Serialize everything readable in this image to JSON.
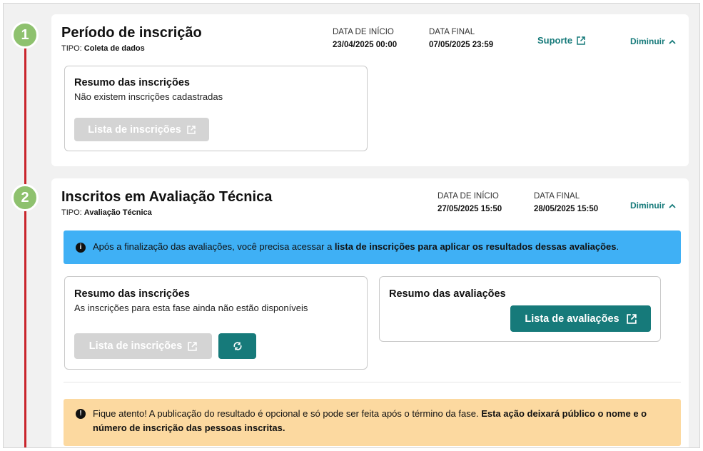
{
  "phases": [
    {
      "number": "1",
      "title": "Período de inscrição",
      "type_label": "TIPO:",
      "type_value": "Coleta de dados",
      "start_label": "DATA DE INÍCIO",
      "start_value": "23/04/2025 00:00",
      "end_label": "DATA FINAL",
      "end_value": "07/05/2025 23:59",
      "support_label": "Suporte",
      "collapse_label": "Diminuir",
      "summary": {
        "title": "Resumo das inscrições",
        "text": "Não existem inscrições cadastradas",
        "button_label": "Lista de inscrições"
      }
    },
    {
      "number": "2",
      "title": "Inscritos em Avaliação Técnica",
      "type_label": "TIPO:",
      "type_value": "Avaliação Técnica",
      "start_label": "DATA DE INÍCIO",
      "start_value": "27/05/2025 15:50",
      "end_label": "DATA FINAL",
      "end_value": "28/05/2025 15:50",
      "collapse_label": "Diminuir",
      "info_alert": {
        "text_before": "Após a finalização das avaliações, você precisa acessar a ",
        "text_bold": "lista de inscrições para aplicar os resultados dessas avaliações",
        "text_after": "."
      },
      "summary": {
        "title": "Resumo das inscrições",
        "text": "As inscrições para esta fase ainda não estão disponíveis",
        "button_label": "Lista de inscrições"
      },
      "evaluations": {
        "title": "Resumo das avaliações",
        "button_label": "Lista de avaliações"
      },
      "warning_alert": {
        "text_before": "Fique atento! A publicação do resultado é opcional e só pode ser feita após o término da fase. ",
        "text_bold": "Esta ação deixará público o nome e o número de inscrição das pessoas inscritas."
      }
    }
  ],
  "colors": {
    "accent_teal": "#167a7a",
    "step_green": "#8ec16e",
    "timeline_red": "#c9252c",
    "info_blue": "#3fb0f5",
    "warning_orange": "#fcd9a0"
  },
  "icons": {
    "external_link": "external-link-icon",
    "chevron_up": "chevron-up-icon",
    "refresh": "refresh-icon",
    "info": "info-icon",
    "alert": "alert-icon"
  }
}
